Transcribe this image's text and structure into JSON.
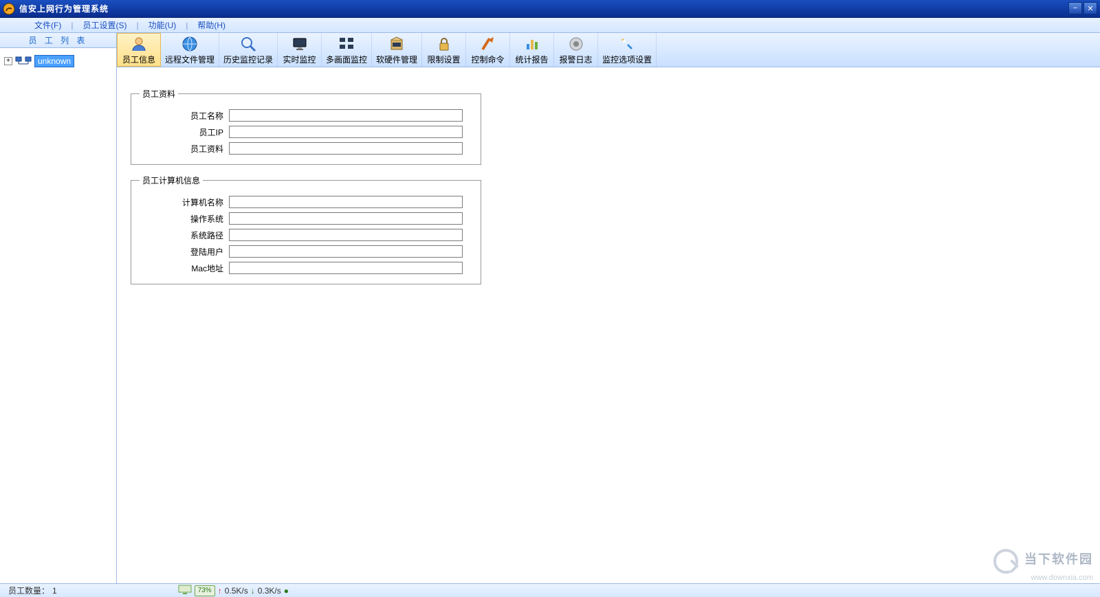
{
  "window": {
    "title": "信安上网行为管理系统"
  },
  "menu": {
    "file": "文件(F)",
    "staff": "员工设置(S)",
    "func": "功能(U)",
    "help": "帮助(H)",
    "sep": "|"
  },
  "sidebar": {
    "header": "员 工 列 表",
    "root_label": "unknown"
  },
  "toolbar": {
    "items": [
      {
        "key": "info",
        "label": "员工信息"
      },
      {
        "key": "remote",
        "label": "远程文件管理"
      },
      {
        "key": "history",
        "label": "历史监控记录"
      },
      {
        "key": "realtime",
        "label": "实时监控"
      },
      {
        "key": "multi",
        "label": "多画面监控"
      },
      {
        "key": "swhw",
        "label": "软硬件管理"
      },
      {
        "key": "limit",
        "label": "限制设置"
      },
      {
        "key": "cmd",
        "label": "控制命令"
      },
      {
        "key": "stats",
        "label": "统计报告"
      },
      {
        "key": "alarm",
        "label": "报警日志"
      },
      {
        "key": "options",
        "label": "监控选项设置"
      }
    ]
  },
  "form": {
    "group1": {
      "legend": "员工资料",
      "rows": [
        {
          "label": "员工名称",
          "value": ""
        },
        {
          "label": "员工IP",
          "value": ""
        },
        {
          "label": "员工资料",
          "value": ""
        }
      ]
    },
    "group2": {
      "legend": "员工计算机信息",
      "rows": [
        {
          "label": "计算机名称",
          "value": ""
        },
        {
          "label": "操作系统",
          "value": ""
        },
        {
          "label": "系统路径",
          "value": ""
        },
        {
          "label": "登陆用户",
          "value": ""
        },
        {
          "label": "Mac地址",
          "value": ""
        }
      ]
    }
  },
  "status": {
    "count_label": "员工数量：",
    "count_value": "1",
    "net_pct": "73%",
    "up_rate": "0.5K/s",
    "down_rate": "0.3K/s"
  },
  "watermark": {
    "title": "当下软件园",
    "url": "www.downxia.com"
  }
}
